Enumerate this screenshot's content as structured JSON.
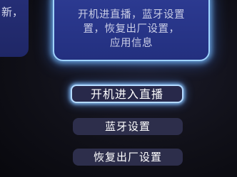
{
  "left_card": {
    "partial_text": "新，"
  },
  "description": {
    "lines": [
      "开机进直播，蓝牙设置",
      "置，恢复出厂设置，",
      "应用信息"
    ]
  },
  "menu": {
    "items": [
      {
        "label": "开机进入直播",
        "selected": true
      },
      {
        "label": "蓝牙设置",
        "selected": false
      },
      {
        "label": "恢复出厂设置",
        "selected": false
      }
    ]
  },
  "colors": {
    "card_blue": "#26328a",
    "focus_glow": "#9fd3ff",
    "menu_bg": "#2d2e4b",
    "text_white": "#ffffff"
  }
}
